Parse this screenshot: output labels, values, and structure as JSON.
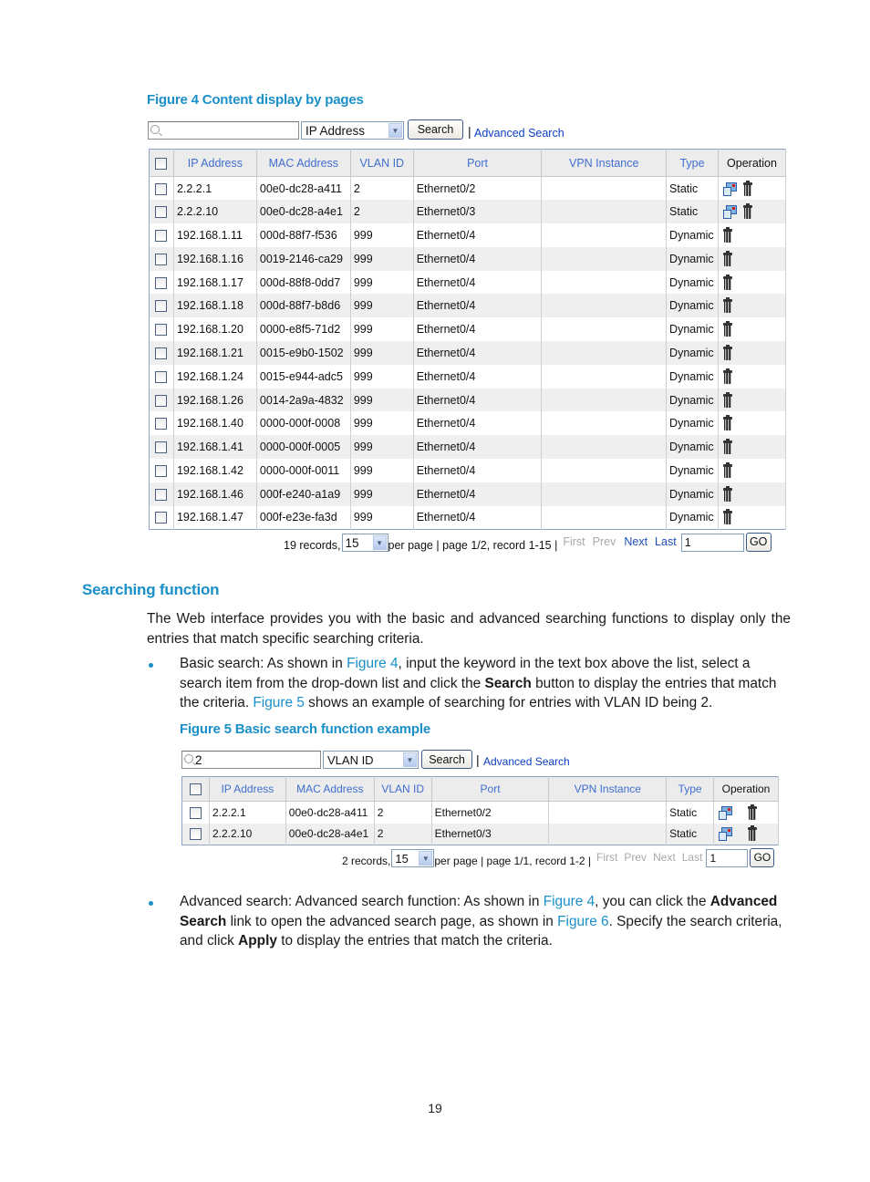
{
  "figure4": {
    "caption": "Figure 4 Content display by pages",
    "search": {
      "input_value": "",
      "select_value": "IP Address",
      "search_button": "Search",
      "separator": "|",
      "advanced_link": "Advanced Search"
    },
    "columns": [
      "IP Address",
      "MAC Address",
      "VLAN ID",
      "Port",
      "VPN Instance",
      "Type",
      "Operation"
    ],
    "rows": [
      {
        "ip": "2.2.2.1",
        "mac": "00e0-dc28-a411",
        "vlan": "2",
        "port": "Ethernet0/2",
        "vpn": "",
        "type": "Static",
        "ops": [
          "edit-icon",
          "delete-icon"
        ]
      },
      {
        "ip": "2.2.2.10",
        "mac": "00e0-dc28-a4e1",
        "vlan": "2",
        "port": "Ethernet0/3",
        "vpn": "",
        "type": "Static",
        "ops": [
          "edit-icon",
          "delete-icon"
        ]
      },
      {
        "ip": "192.168.1.11",
        "mac": "000d-88f7-f536",
        "vlan": "999",
        "port": "Ethernet0/4",
        "vpn": "",
        "type": "Dynamic",
        "ops": [
          "delete-icon"
        ]
      },
      {
        "ip": "192.168.1.16",
        "mac": "0019-2146-ca29",
        "vlan": "999",
        "port": "Ethernet0/4",
        "vpn": "",
        "type": "Dynamic",
        "ops": [
          "delete-icon"
        ]
      },
      {
        "ip": "192.168.1.17",
        "mac": "000d-88f8-0dd7",
        "vlan": "999",
        "port": "Ethernet0/4",
        "vpn": "",
        "type": "Dynamic",
        "ops": [
          "delete-icon"
        ]
      },
      {
        "ip": "192.168.1.18",
        "mac": "000d-88f7-b8d6",
        "vlan": "999",
        "port": "Ethernet0/4",
        "vpn": "",
        "type": "Dynamic",
        "ops": [
          "delete-icon"
        ]
      },
      {
        "ip": "192.168.1.20",
        "mac": "0000-e8f5-71d2",
        "vlan": "999",
        "port": "Ethernet0/4",
        "vpn": "",
        "type": "Dynamic",
        "ops": [
          "delete-icon"
        ]
      },
      {
        "ip": "192.168.1.21",
        "mac": "0015-e9b0-1502",
        "vlan": "999",
        "port": "Ethernet0/4",
        "vpn": "",
        "type": "Dynamic",
        "ops": [
          "delete-icon"
        ]
      },
      {
        "ip": "192.168.1.24",
        "mac": "0015-e944-adc5",
        "vlan": "999",
        "port": "Ethernet0/4",
        "vpn": "",
        "type": "Dynamic",
        "ops": [
          "delete-icon"
        ]
      },
      {
        "ip": "192.168.1.26",
        "mac": "0014-2a9a-4832",
        "vlan": "999",
        "port": "Ethernet0/4",
        "vpn": "",
        "type": "Dynamic",
        "ops": [
          "delete-icon"
        ]
      },
      {
        "ip": "192.168.1.40",
        "mac": "0000-000f-0008",
        "vlan": "999",
        "port": "Ethernet0/4",
        "vpn": "",
        "type": "Dynamic",
        "ops": [
          "delete-icon"
        ]
      },
      {
        "ip": "192.168.1.41",
        "mac": "0000-000f-0005",
        "vlan": "999",
        "port": "Ethernet0/4",
        "vpn": "",
        "type": "Dynamic",
        "ops": [
          "delete-icon"
        ]
      },
      {
        "ip": "192.168.1.42",
        "mac": "0000-000f-0011",
        "vlan": "999",
        "port": "Ethernet0/4",
        "vpn": "",
        "type": "Dynamic",
        "ops": [
          "delete-icon"
        ]
      },
      {
        "ip": "192.168.1.46",
        "mac": "000f-e240-a1a9",
        "vlan": "999",
        "port": "Ethernet0/4",
        "vpn": "",
        "type": "Dynamic",
        "ops": [
          "delete-icon"
        ]
      },
      {
        "ip": "192.168.1.47",
        "mac": "000f-e23e-fa3d",
        "vlan": "999",
        "port": "Ethernet0/4",
        "vpn": "",
        "type": "Dynamic",
        "ops": [
          "delete-icon"
        ]
      }
    ],
    "pager": {
      "records": "19 records,",
      "per_page_value": "15",
      "info": "per page | page 1/2, record 1-15 |",
      "first": "First",
      "prev": "Prev",
      "next": "Next",
      "last": "Last",
      "page_input": "1",
      "go": "GO",
      "first_enabled": false,
      "prev_enabled": false,
      "next_enabled": true,
      "last_enabled": true
    }
  },
  "section": {
    "heading": "Searching function",
    "intro": "The Web interface provides you with the basic and advanced searching functions to display only the entries that match specific searching criteria.",
    "basic": {
      "p1": "Basic search: As shown in ",
      "link1": "Figure 4",
      "p2": ", input the keyword in the text box above the list, select a search item from the drop-down list and click the ",
      "bold1": "Search",
      "p3": " button to display the entries that match the criteria. ",
      "link2": "Figure 5",
      "p4": " shows an example of searching for entries with VLAN ID being 2."
    },
    "advanced": {
      "p1": "Advanced search: Advanced search function: As shown in ",
      "link1": "Figure 4",
      "p2": ", you can click the ",
      "bold1": "Advanced Search",
      "p3": " link to open the advanced search page, as shown in ",
      "link2": "Figure 6",
      "p4": ". Specify the search criteria, and click ",
      "bold2": "Apply",
      "p5": " to display the entries that match the criteria."
    }
  },
  "figure5": {
    "caption": "Figure 5 Basic search function example",
    "search": {
      "input_value": "2",
      "select_value": "VLAN ID",
      "search_button": "Search",
      "separator": "|",
      "advanced_link": "Advanced Search"
    },
    "columns": [
      "IP Address",
      "MAC Address",
      "VLAN ID",
      "Port",
      "VPN Instance",
      "Type",
      "Operation"
    ],
    "rows": [
      {
        "ip": "2.2.2.1",
        "mac": "00e0-dc28-a411",
        "vlan": "2",
        "port": "Ethernet0/2",
        "vpn": "",
        "type": "Static",
        "ops": [
          "edit-icon",
          "delete-icon"
        ]
      },
      {
        "ip": "2.2.2.10",
        "mac": "00e0-dc28-a4e1",
        "vlan": "2",
        "port": "Ethernet0/3",
        "vpn": "",
        "type": "Static",
        "ops": [
          "edit-icon",
          "delete-icon"
        ]
      }
    ],
    "pager": {
      "records": "2 records,",
      "per_page_value": "15",
      "info": "per page | page 1/1, record 1-2 |",
      "first": "First",
      "prev": "Prev",
      "next": "Next",
      "last": "Last",
      "page_input": "1",
      "go": "GO",
      "first_enabled": false,
      "prev_enabled": false,
      "next_enabled": false,
      "last_enabled": false
    }
  },
  "footer": {
    "page_number": "19"
  },
  "colors": {
    "heading_blue": "#1a8fc8",
    "table_header_text": "#3f6ecf",
    "link_blue": "#0b3fc1",
    "row_alt": "#eeefee",
    "disabled_link": "#a8a8a8"
  }
}
